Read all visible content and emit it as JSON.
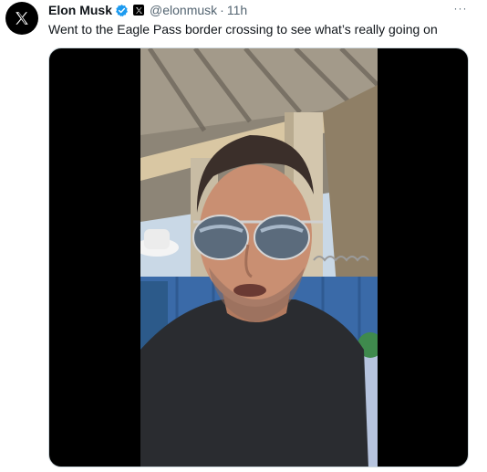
{
  "tweet": {
    "display_name": "Elon Musk",
    "verified_icon": "verified-badge-icon",
    "affiliate_icon": "x-logo-icon",
    "handle": "@elonmusk",
    "separator": "·",
    "timestamp": "11h",
    "more_icon": "more-options-icon",
    "more_label": "···",
    "text": "Went to the Eagle Pass border crossing to see what’s really going on"
  },
  "media": {
    "type": "video",
    "icon": "video-frame"
  },
  "colors": {
    "verified_blue": "#1d9bf0",
    "muted_text": "#536471",
    "text": "#0f1419",
    "letterbox": "#000000"
  }
}
